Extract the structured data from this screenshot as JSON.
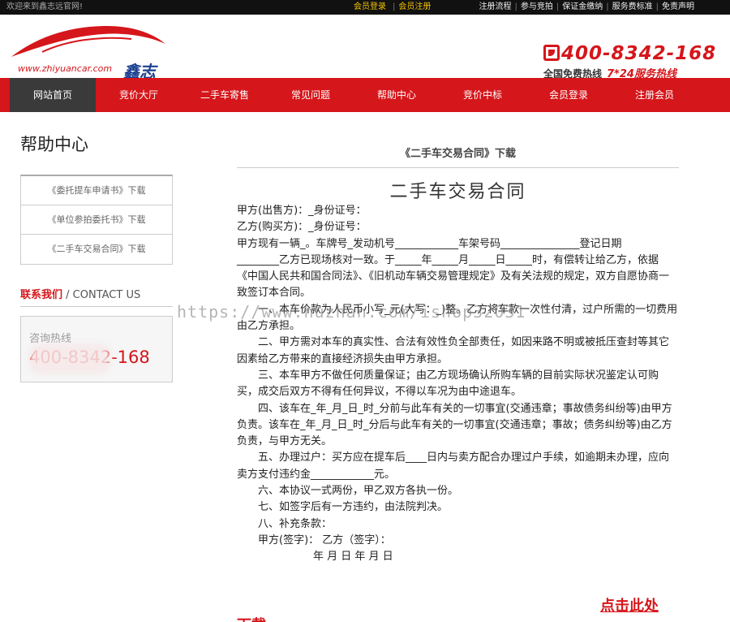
{
  "topbar": {
    "welcome": "欢迎来到鑫志远官网!",
    "member_login": "会员登录",
    "member_register": "会员注册",
    "links": [
      "注册流程",
      "参与竞拍",
      "保证金缴纳",
      "服务费标准",
      "免责声明"
    ]
  },
  "header": {
    "logo_url": "www.zhiyuancar.com",
    "logo_brand": "鑫志远",
    "hotline": "400-8342-168",
    "hotline_sub": "全国免费热线",
    "hotline_sub2": "7*24服务热线"
  },
  "nav": [
    "网站首页",
    "竞价大厅",
    "二手车寄售",
    "常见问题",
    "帮助中心",
    "竞价中标",
    "会员登录",
    "注册会员"
  ],
  "sidebar": {
    "title": "帮助中心",
    "items": [
      "《委托提车申请书》下载",
      "《单位参拍委托书》下载",
      "《二手车交易合同》下载"
    ],
    "contact_cn": "联系我们",
    "contact_en": " / CONTACT US",
    "contact_label": "咨询热线",
    "contact_number": "400-8342-168"
  },
  "main": {
    "heading": "《二手车交易合同》下载",
    "contract_title": "二手车交易合同",
    "lines": [
      "甲方(出售方)：_身份证号：",
      "乙方(购买方)：_身份证号：",
      "甲方现有一辆_。车牌号_发动机号____________车架号码_______________登记日期"
    ],
    "para1": "________乙方已现场核对一致。于_____年_____月_____日_____时，有偿转让给乙方，依据《中国人民共和国合同法》、《旧机动车辆交易管理规定》及有关法规的规定，双方自愿协商一致签订本合同。",
    "clauses": [
      "一、本车价款为人民币小写_元(大写：_)整。乙方将车款一次性付清，过户所需的一切费用由乙方承担。",
      "二、甲方需对本车的真实性、合法有效性负全部责任，如因来路不明或被抵压查封等其它因素给乙方带来的直接经济损失由甲方承担。",
      "三、本车甲方不做任何质量保证；由乙方现场确认所购车辆的目前实际状况鉴定认可购买，成交后双方不得有任何异议，不得以车况为由中途退车。",
      "四、该车在_年_月_日_时_分前与此车有关的一切事宜(交通违章；事故债务纠纷等)由甲方负责。该车在_年_月_日_时_分后与此车有关的一切事宜(交通违章；事故；债务纠纷等)由乙方负责，与甲方无关。",
      "五、办理过户：买方应在提车后____日内与卖方配合办理过户手续，如逾期未办理，应向卖方支付违约金____________元。",
      "六、本协议一式两份，甲乙双方各执一份。",
      "七、如签字后有一方违约，由法院判决。",
      "八、补充条款：",
      "甲方(签字)：   乙方（签字）："
    ],
    "date_line": "年 月 日 年 月 日",
    "watermark": "https://www.huzhan.com/ishop32031",
    "download_label": "点击此处",
    "download_tail": "下载"
  }
}
